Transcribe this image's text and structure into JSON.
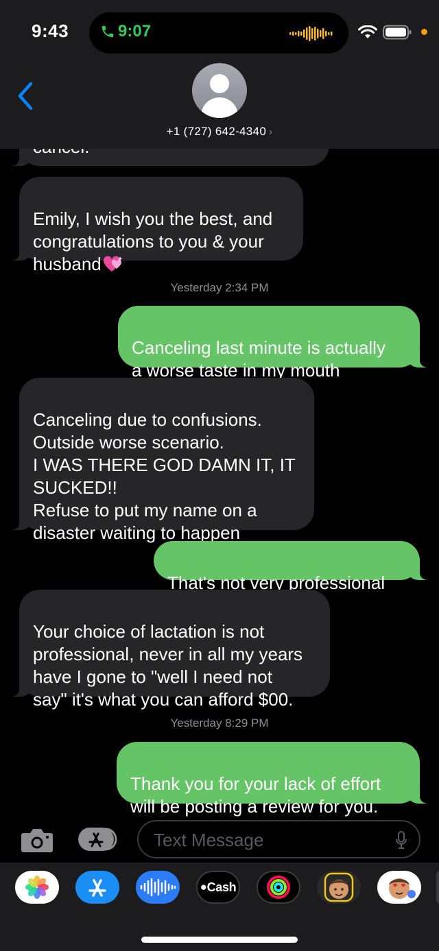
{
  "status_bar": {
    "time": "9:43",
    "call_time": "9:07"
  },
  "header": {
    "contact": "+1 (727) 642-4340",
    "contact_chevron": "›"
  },
  "conversation": {
    "partial_top": "cancel.",
    "messages": [
      {
        "type": "in",
        "text": "Emily, I wish you the best, and\ncongratulations to you & your\nhusband",
        "emoji": "sparkling-heart-icon"
      },
      {
        "type": "timestamp",
        "text": "Yesterday 2:34 PM"
      },
      {
        "type": "out",
        "text": "Canceling last minute is actually\na worse taste in my mouth"
      },
      {
        "type": "in",
        "text": "Canceling due to confusions.\nOutside worse scenario.\nI WAS THERE GOD DAMN IT, IT\nSUCKED!!\nRefuse to put my name on a\ndisaster waiting to happen"
      },
      {
        "type": "out",
        "text": "That's not very professional"
      },
      {
        "type": "in",
        "text": "Your choice of lactation is not\nprofessional, never in all my years\nhave I gone to \"well I need not\nsay\" it's what you can afford $00."
      },
      {
        "type": "timestamp",
        "text": "Yesterday 8:29 PM"
      },
      {
        "type": "out",
        "text": "Thank you for your lack of effort\nwill be posting a review for you."
      }
    ]
  },
  "input": {
    "placeholder": "Text Message"
  },
  "app_drawer": {
    "apps": [
      "Photos",
      "App Store",
      "Audio",
      "Cash",
      "Fitness",
      "Memoji",
      "Memoji Stickers"
    ],
    "cash_label": "Cash"
  },
  "colors": {
    "outgoing": "#65c466",
    "incoming": "#262629",
    "accent": "#0a84ff",
    "call": "#34c759"
  }
}
